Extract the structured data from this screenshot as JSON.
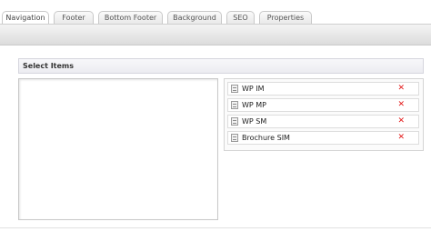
{
  "tabs": [
    {
      "label": "Navigation"
    },
    {
      "label": "Footer"
    },
    {
      "label": "Bottom Footer"
    },
    {
      "label": "Background"
    },
    {
      "label": "SEO"
    },
    {
      "label": "Properties"
    }
  ],
  "section": {
    "title": "Select Items"
  },
  "selected_items": [
    {
      "label": "WP IM",
      "icon": "page-icon",
      "remove_icon": "remove-x-icon",
      "remove_glyph": "✕"
    },
    {
      "label": "WP MP",
      "icon": "page-icon",
      "remove_icon": "remove-x-icon",
      "remove_glyph": "✕"
    },
    {
      "label": "WP SM",
      "icon": "page-icon",
      "remove_icon": "remove-x-icon",
      "remove_glyph": "✕"
    },
    {
      "label": "Brochure SIM",
      "icon": "page-icon",
      "remove_icon": "remove-x-icon",
      "remove_glyph": "✕"
    }
  ],
  "colors": {
    "remove": "#e31b1b",
    "border": "#c8c8c8",
    "header_bg": "#ececf1"
  }
}
